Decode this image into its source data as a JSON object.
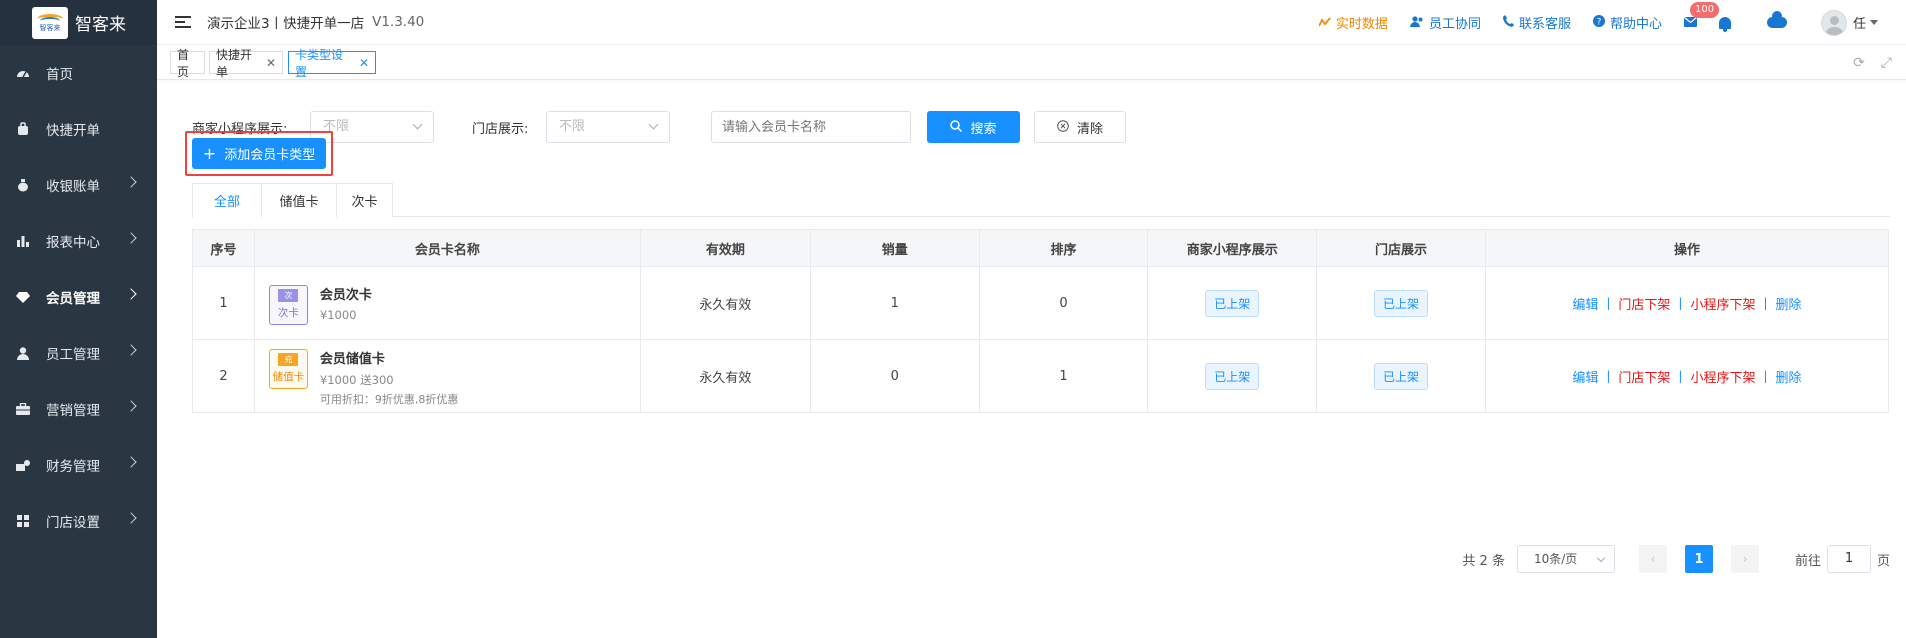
{
  "brand": {
    "name": "智客来",
    "logo_text": "智客来"
  },
  "sidebar": {
    "items": [
      {
        "label": "首页",
        "icon": "dashboard-icon",
        "has_arrow": false,
        "active": false
      },
      {
        "label": "快捷开单",
        "icon": "bag-icon",
        "has_arrow": false,
        "active": false
      },
      {
        "label": "收银账单",
        "icon": "money-bag-icon",
        "has_arrow": true,
        "active": false
      },
      {
        "label": "报表中心",
        "icon": "bar-chart-icon",
        "has_arrow": true,
        "active": false
      },
      {
        "label": "会员管理",
        "icon": "diamond-icon",
        "has_arrow": true,
        "active": true
      },
      {
        "label": "员工管理",
        "icon": "user-icon",
        "has_arrow": true,
        "active": false
      },
      {
        "label": "营销管理",
        "icon": "briefcase-icon",
        "has_arrow": true,
        "active": false
      },
      {
        "label": "财务管理",
        "icon": "finance-icon",
        "has_arrow": true,
        "active": false
      },
      {
        "label": "门店设置",
        "icon": "grid-icon",
        "has_arrow": true,
        "active": false
      }
    ]
  },
  "header": {
    "company": "演示企业3丨快捷开单一店",
    "version": "V1.3.40",
    "links": {
      "realtime": "实时数据",
      "staff": "员工协同",
      "service": "联系客服",
      "help": "帮助中心"
    },
    "mail_badge": "100",
    "user": "任"
  },
  "tags": [
    {
      "label": "首页",
      "closable": false,
      "active": false
    },
    {
      "label": "快捷开单",
      "closable": true,
      "active": false
    },
    {
      "label": "卡类型设置",
      "closable": true,
      "active": true
    }
  ],
  "filters": {
    "mini_label": "商家小程序展示:",
    "mini_value": "不限",
    "store_label": "门店展示:",
    "store_value": "不限",
    "search_placeholder": "请输入会员卡名称",
    "search_btn": "搜索",
    "clear_btn": "清除"
  },
  "add_button": "添加会员卡类型",
  "tabs": [
    "全部",
    "储值卡",
    "次卡"
  ],
  "table": {
    "headers": [
      "序号",
      "会员卡名称",
      "有效期",
      "销量",
      "排序",
      "商家小程序展示",
      "门店展示",
      "操作"
    ],
    "rows": [
      {
        "index": "1",
        "icon_top": "次",
        "icon_label": "次卡",
        "icon_style": "purple",
        "name": "会员次卡",
        "price": "¥1000",
        "extra": "",
        "validity": "永久有效",
        "sales": "1",
        "sort": "0",
        "mini_status": "已上架",
        "store_status": "已上架"
      },
      {
        "index": "2",
        "icon_top": "充",
        "icon_label": "储值卡",
        "icon_style": "orange",
        "name": "会员储值卡",
        "price": "¥1000 送300",
        "extra": "可用折扣：9折优惠,8折优惠",
        "validity": "永久有效",
        "sales": "0",
        "sort": "1",
        "mini_status": "已上架",
        "store_status": "已上架"
      }
    ],
    "ops": {
      "edit": "编辑",
      "store_off": "门店下架",
      "mini_off": "小程序下架",
      "delete": "删除"
    }
  },
  "pagination": {
    "total": "共 2 条",
    "page_size": "10条/页",
    "current": "1",
    "goto_label": "前往",
    "goto_value": "1",
    "page_suffix": "页"
  },
  "colors": {
    "primary": "#1890ff",
    "sidebar_bg": "#2b3643",
    "danger": "#e61414",
    "highlight_border": "#f04040"
  }
}
